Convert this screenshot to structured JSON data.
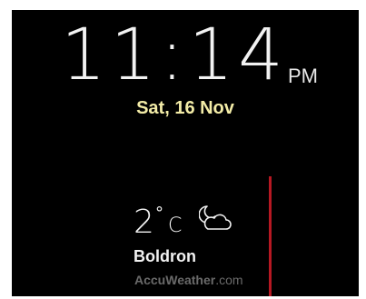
{
  "clock": {
    "time": "11:14",
    "period": "PM",
    "date": "Sat, 16 Nov"
  },
  "weather": {
    "temperature": "2",
    "degree_symbol": "°",
    "unit": "C",
    "condition_icon": "moon-cloud-icon",
    "location": "Boldron",
    "provider_name": "AccuWeather",
    "provider_domain": ".com"
  },
  "colors": {
    "background": "#000000",
    "date_text": "#f3eca7",
    "divider": "#b61822",
    "provider_text": "#6a6a6a"
  }
}
